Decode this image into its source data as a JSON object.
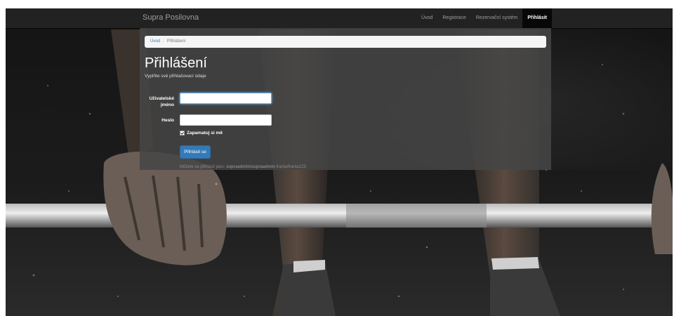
{
  "navbar": {
    "brand": "Supra Posilovna",
    "items": [
      {
        "label": "Úvod"
      },
      {
        "label": "Registrace"
      },
      {
        "label": "Rezervační systém"
      },
      {
        "label": "Přihlásit"
      }
    ]
  },
  "breadcrumb": {
    "home": "Úvod",
    "current": "Přihlášení"
  },
  "login": {
    "title": "Přihlášení",
    "subtitle": "Vyplňte své přihlašovací údaje",
    "username_label": "Uživatelské jméno",
    "password_label": "Heslo",
    "username_value": "",
    "password_value": "",
    "remember_label": "Zapamatuj si mě",
    "submit_label": "Přihlásit se",
    "hint_prefix": "Můžete se přihlásit jako:",
    "hint_accounts": "supraadmin/supraadmin",
    "hint_other": "franta/franta123"
  },
  "colors": {
    "navbar": "#222222",
    "primary": "#337ab7",
    "panel": "#464646"
  },
  "icons": {
    "checkbox": "check-icon"
  }
}
